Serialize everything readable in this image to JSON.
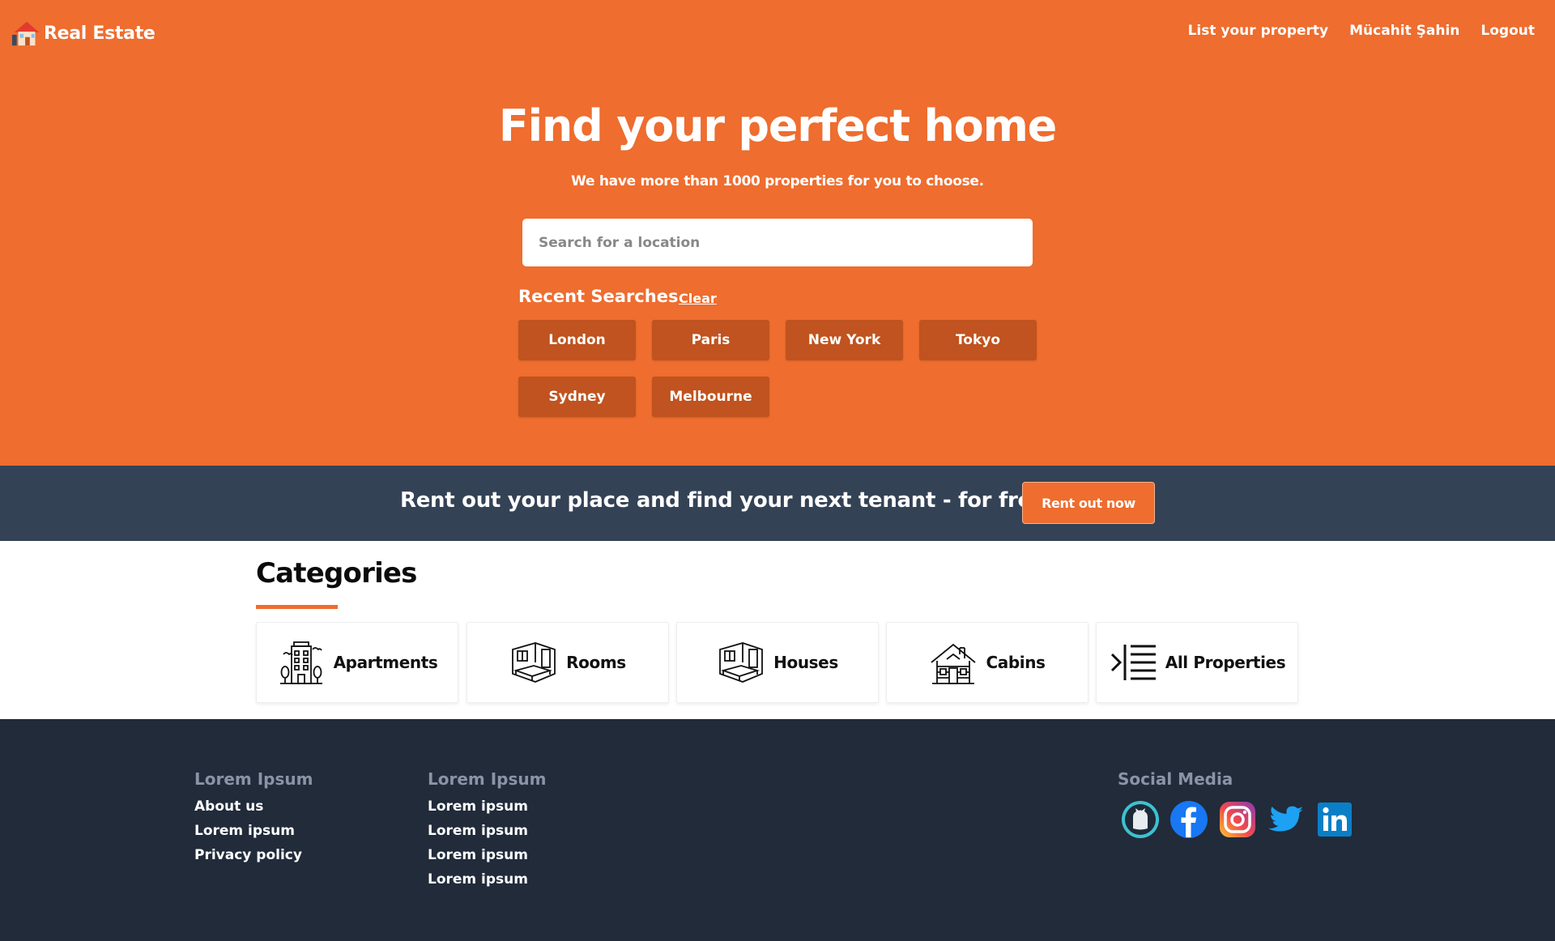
{
  "brand": {
    "name": "Real Estate",
    "icon": "house-logo-icon"
  },
  "nav": {
    "links": [
      "List your property",
      "Mücahit Şahin",
      "Logout"
    ]
  },
  "hero": {
    "title": "Find your perfect home",
    "subtitle": "We have more than 1000 properties for you to choose.",
    "search_placeholder": "Search for a location"
  },
  "recent_searches": {
    "title": "Recent Searches",
    "clear_label": "Clear",
    "items": [
      "London",
      "Paris",
      "New York",
      "Tokyo",
      "Sydney",
      "Melbourne"
    ]
  },
  "banner": {
    "text": "Rent out your place and find your next tenant - for free",
    "button_label": "Rent out now"
  },
  "categories": {
    "title": "Categories",
    "items": [
      {
        "label": "Apartments",
        "icon": "apartment-building-icon"
      },
      {
        "label": "Rooms",
        "icon": "room-icon"
      },
      {
        "label": "Houses",
        "icon": "house-icon"
      },
      {
        "label": "Cabins",
        "icon": "cabin-icon"
      },
      {
        "label": "All Properties",
        "icon": "list-icon"
      }
    ]
  },
  "footer": {
    "col1": {
      "heading": "Lorem Ipsum",
      "links": [
        "About us",
        "Lorem ipsum",
        "Privacy policy"
      ]
    },
    "col2": {
      "heading": "Lorem Ipsum",
      "links": [
        "Lorem ipsum",
        "Lorem ipsum",
        "Lorem ipsum",
        "Lorem ipsum"
      ]
    },
    "social": {
      "heading": "Social Media",
      "icons": [
        "github-icon",
        "facebook-icon",
        "instagram-icon",
        "twitter-icon",
        "linkedin-icon"
      ]
    }
  },
  "colors": {
    "hero_bg": "#ee6d2f",
    "chip_bg": "#c0531f",
    "banner_bg": "#344256",
    "footer_bg": "#212b3a",
    "footer_heading": "#8a94a6"
  }
}
